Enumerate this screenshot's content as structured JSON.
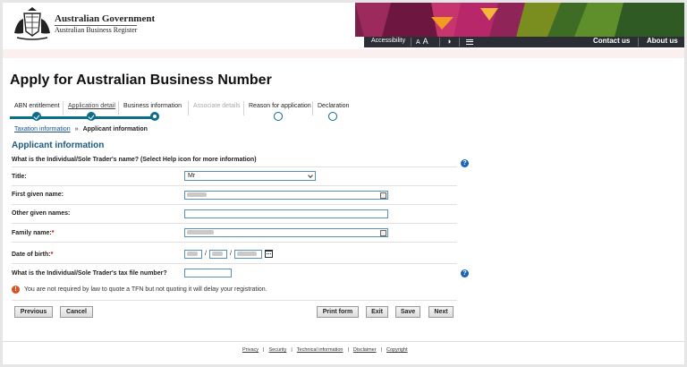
{
  "header": {
    "gov_line1": "Australian Government",
    "gov_line2": "Australian Business Register",
    "accessibility": "Accessibility",
    "text_size_small": "A",
    "text_size_large": "A",
    "contact_us": "Contact us",
    "about_us": "About us"
  },
  "page_title": "Apply for Australian Business Number",
  "steps": [
    {
      "label": "ABN entitlement",
      "state": "done"
    },
    {
      "label": "Application detail",
      "state": "done"
    },
    {
      "label": "Business information",
      "state": "current"
    },
    {
      "label": "Associate details",
      "state": "disabled"
    },
    {
      "label": "Reason for application",
      "state": "todo"
    },
    {
      "label": "Declaration",
      "state": "todo"
    }
  ],
  "breadcrumb": {
    "link": "Taxation information",
    "separator": "»",
    "current": "Applicant information"
  },
  "section_title": "Applicant information",
  "question": "What is the Individual/Sole Trader's name? (Select Help icon for more information)",
  "fields": {
    "title_label": "Title:",
    "title_value": "Mr",
    "first_name_label": "First given name:",
    "other_names_label": "Other given names:",
    "family_name_label": "Family name:",
    "required_mark": "*",
    "dob_label": "Date of birth:",
    "date_separator": "/",
    "tfn_label": "What is the Individual/Sole Trader's tax file number?"
  },
  "warning": "You are not required by law to quote a TFN but not quoting it will delay your registration.",
  "buttons": {
    "previous": "Previous",
    "cancel": "Cancel",
    "print": "Print form",
    "exit": "Exit",
    "save": "Save",
    "next": "Next"
  },
  "footer": [
    "Privacy",
    "Security",
    "Technical information",
    "Disclaimer",
    "Copyright"
  ],
  "footer_separator": "|",
  "colors": {
    "accent": "#0a6e8c",
    "topbar": "#2b2f35",
    "section_title": "#1c5a80",
    "help_icon": "#1a63b8",
    "warning_icon": "#d9531e"
  }
}
